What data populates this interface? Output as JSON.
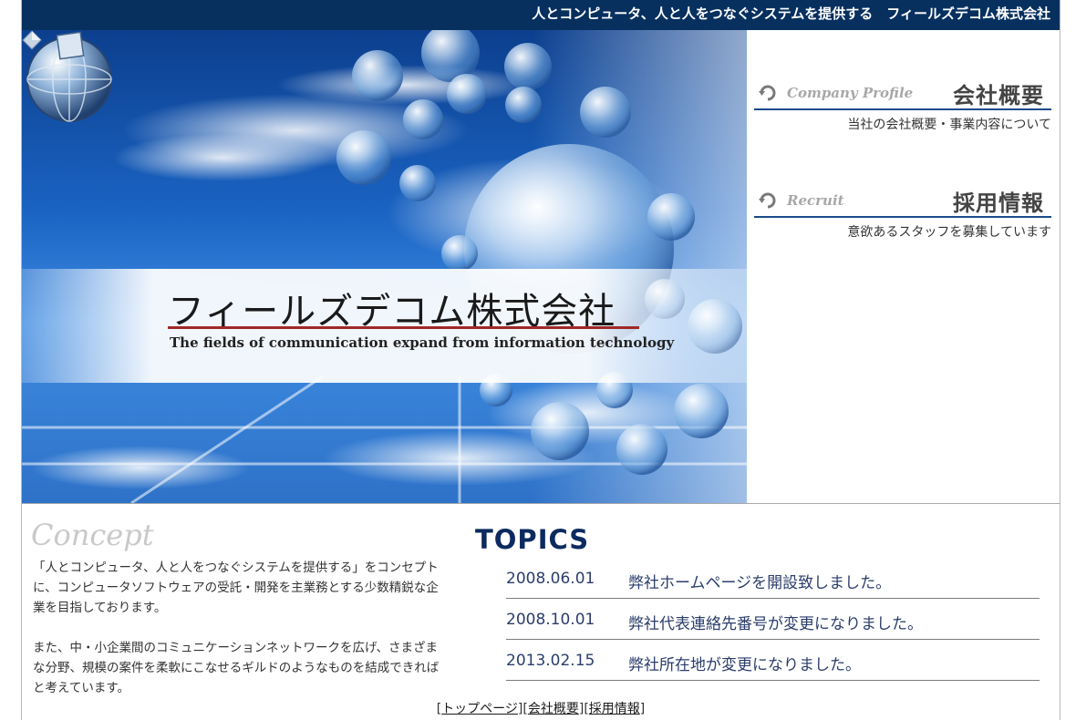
{
  "header": {
    "tagline": "人とコンピュータ、人と人をつなぐシステムを提供する　フィールズデコム株式会社"
  },
  "hero": {
    "company_name_jp": "フィールズデコム株式会社",
    "company_name_en": "The fields of communication expand from information technology"
  },
  "nav": [
    {
      "label_en": "Company Profile",
      "label_jp": "会社概要",
      "description": "当社の会社概要・事業内容について"
    },
    {
      "label_en": "Recruit",
      "label_jp": "採用情報",
      "description": "意欲あるスタッフを募集しています"
    }
  ],
  "concept": {
    "title": "Concept",
    "paragraphs": [
      "「人とコンピュータ、人と人をつなぐシステムを提供する」をコンセプトに、コンピュータソフトウェアの受託・開発を主業務とする少数精鋭な企業を目指しております。",
      "また、中・小企業間のコミュニケーションネットワークを広げ、さまざまな分野、規模の案件を柔軟にこなせるギルドのようなものを結成できればと考えています。"
    ]
  },
  "topics": {
    "title": "TOPICS",
    "items": [
      {
        "date": "2008.06.01",
        "text": "弊社ホームページを開設致しました。"
      },
      {
        "date": "2008.10.01",
        "text": "弊社代表連絡先番号が変更になりました。"
      },
      {
        "date": "2013.02.15",
        "text": "弊社所在地が変更になりました。"
      }
    ]
  },
  "footer": {
    "links": [
      "トップページ",
      "会社概要",
      "採用情報"
    ]
  },
  "colors": {
    "header_bg": "#07305f",
    "topics_title": "#0b2a5f",
    "nav_rule": "#1a4a8a",
    "logo_rule": "#a02828"
  },
  "icons": [
    "globe-logo-icon",
    "diamond-icon",
    "circular-arrow-icon"
  ]
}
